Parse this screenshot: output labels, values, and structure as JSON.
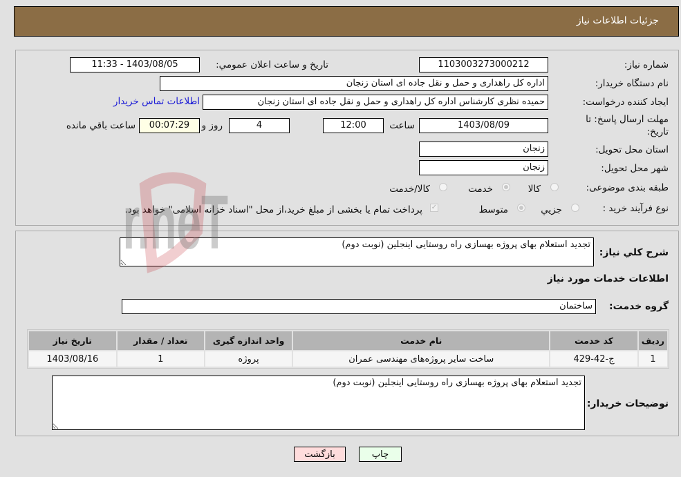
{
  "header": {
    "title": "جزئیات اطلاعات نیاز"
  },
  "form": {
    "need_number": {
      "label": "شماره نیاز:",
      "value": "1103003273000212"
    },
    "announce_datetime": {
      "label": "تاریخ و ساعت اعلان عمومي:",
      "value": "1403/08/05 - 11:33"
    },
    "buyer_org": {
      "label": "نام دستگاه خریدار:",
      "value": "اداره کل راهداری و حمل و نقل جاده ای استان زنجان"
    },
    "requester": {
      "label": "ایجاد کننده درخواست:",
      "value": "حمیده نظری کارشناس اداره کل راهداری و حمل و نقل جاده ای استان زنجان"
    },
    "buyer_contact_link": "اطلاعات تماس خریدار",
    "deadline": {
      "label": "مهلت ارسال پاسخ: تا تاریخ:",
      "date": "1403/08/09",
      "time_label": "ساعت",
      "time": "12:00",
      "days": "4",
      "days_label": "روز و",
      "remaining": "00:07:29",
      "remaining_label": "ساعت باقي مانده"
    },
    "delivery_province": {
      "label": "استان محل تحویل:",
      "value": "زنجان"
    },
    "delivery_city": {
      "label": "شهر محل تحویل:",
      "value": "زنجان"
    },
    "category": {
      "label": "طبقه بندی موضوعی:",
      "options": [
        "کالا",
        "خدمت",
        "کالا/خدمت"
      ],
      "selected": "خدمت"
    },
    "purchase_process": {
      "label": "نوع فرآیند خرید :",
      "options": [
        "جزيي",
        "متوسط"
      ],
      "selected": "متوسط",
      "treasury_checkbox_label": "پرداخت تمام یا بخشی از مبلغ خرید،از محل \"اسناد خزانه اسلامی\" خواهد بود.",
      "treasury_checked": true
    }
  },
  "description": {
    "label": "شرح کلي نیاز:",
    "value": "تجدید استعلام بهای پروژه بهسازی راه روستایی اینجلین (نوبت دوم)"
  },
  "services_section": {
    "title": "اطلاعات خدمات مورد نیاز",
    "service_group_label": "گروه خدمت:",
    "service_group_value": "ساختمان",
    "table": {
      "columns": [
        "ردیف",
        "کد خدمت",
        "نام خدمت",
        "واحد اندازه گیری",
        "تعداد / مقدار",
        "تاریخ نیاز"
      ],
      "rows": [
        [
          "1",
          "ج-42-429",
          "ساخت سایر پروژه‌های مهندسی عمران",
          "پروژه",
          "1",
          "1403/08/16"
        ]
      ]
    },
    "buyer_notes_label": "توضیحات خریدار:",
    "buyer_notes_value": "تجدید استعلام بهای پروژه بهسازی راه روستایی اینجلین (نوبت دوم)"
  },
  "buttons": {
    "print": "چاپ",
    "back": "بازگشت"
  },
  "watermark": "AriaTender.neT",
  "colors": {
    "header_bg": "#8b6d45",
    "print_bg": "#eaffea",
    "back_bg": "#ffdcdc",
    "link": "#1a1ad6"
  }
}
